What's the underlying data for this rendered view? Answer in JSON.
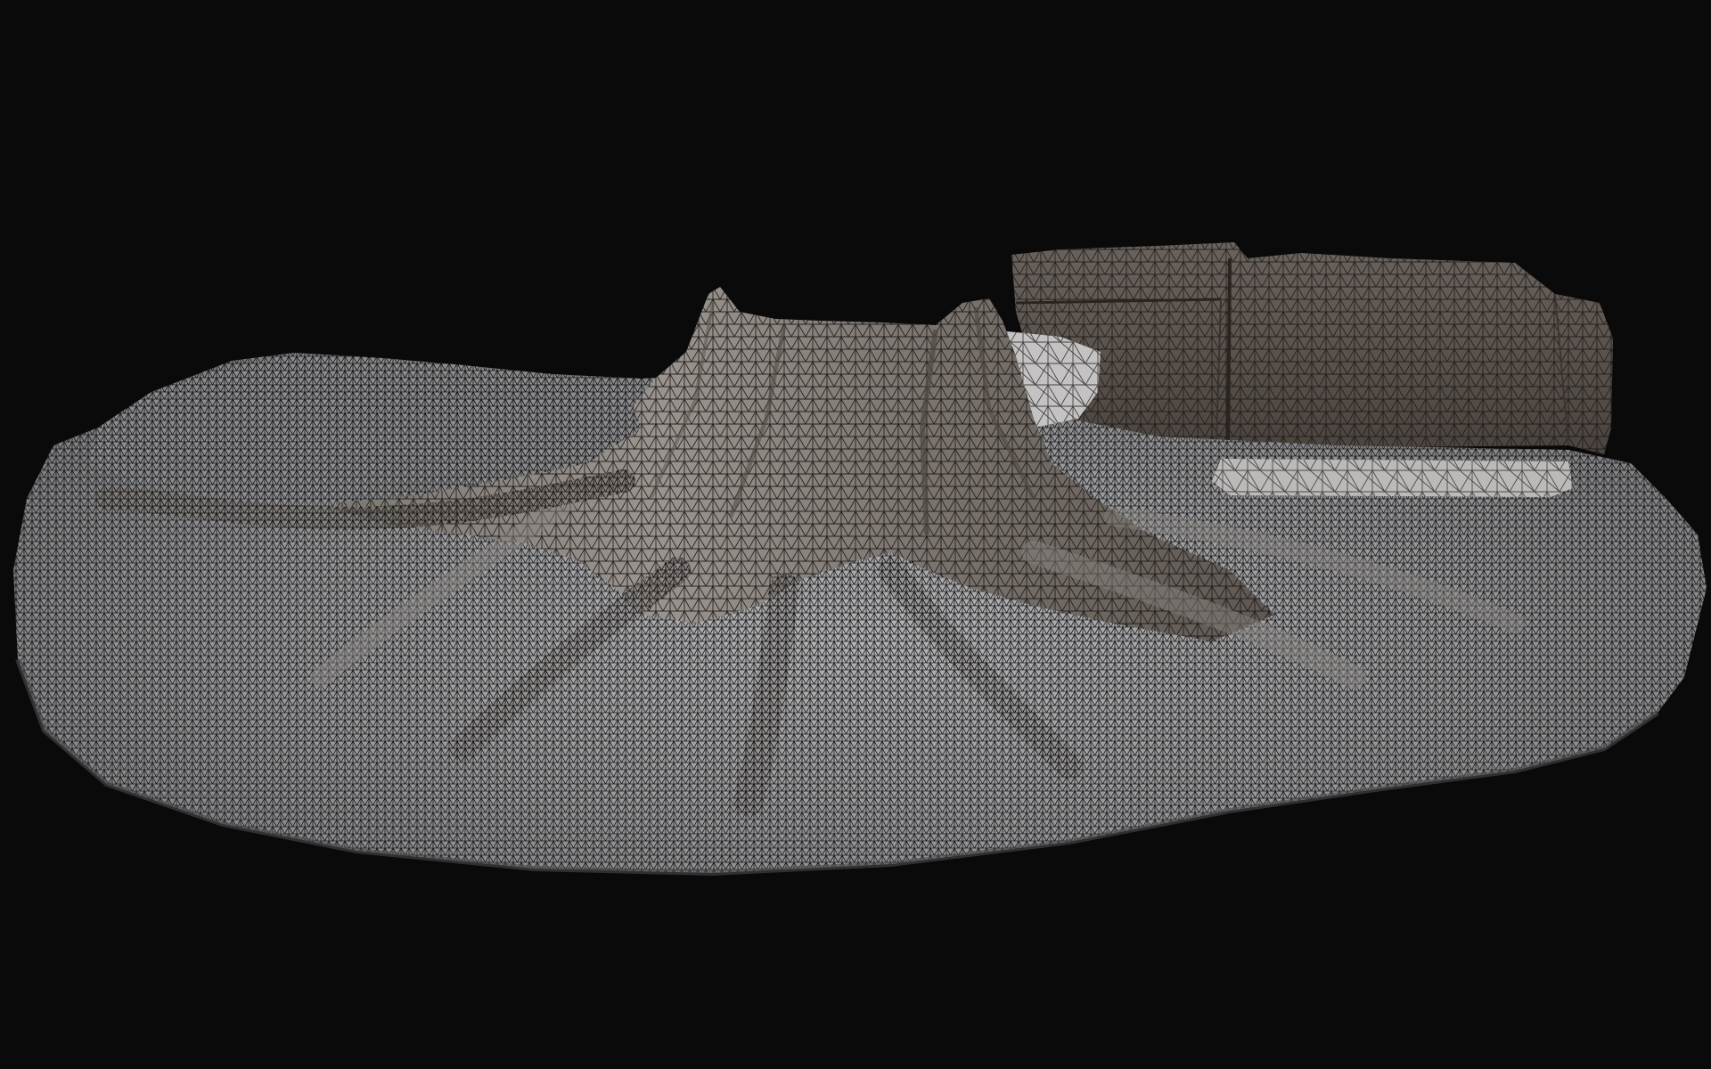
{
  "viewport": {
    "background": "#0a0a0b",
    "mode": "wireframe-shaded",
    "model": "tree-stump-with-roots-and-stone-wall",
    "colors": {
      "ground_fill": "#8d8d90",
      "ground_light": "#c9c9cc",
      "stump_fill": "#6f6862",
      "wall_fill": "#574e48",
      "slab_fill": "#b9b7b6",
      "wire": "#151515"
    }
  }
}
